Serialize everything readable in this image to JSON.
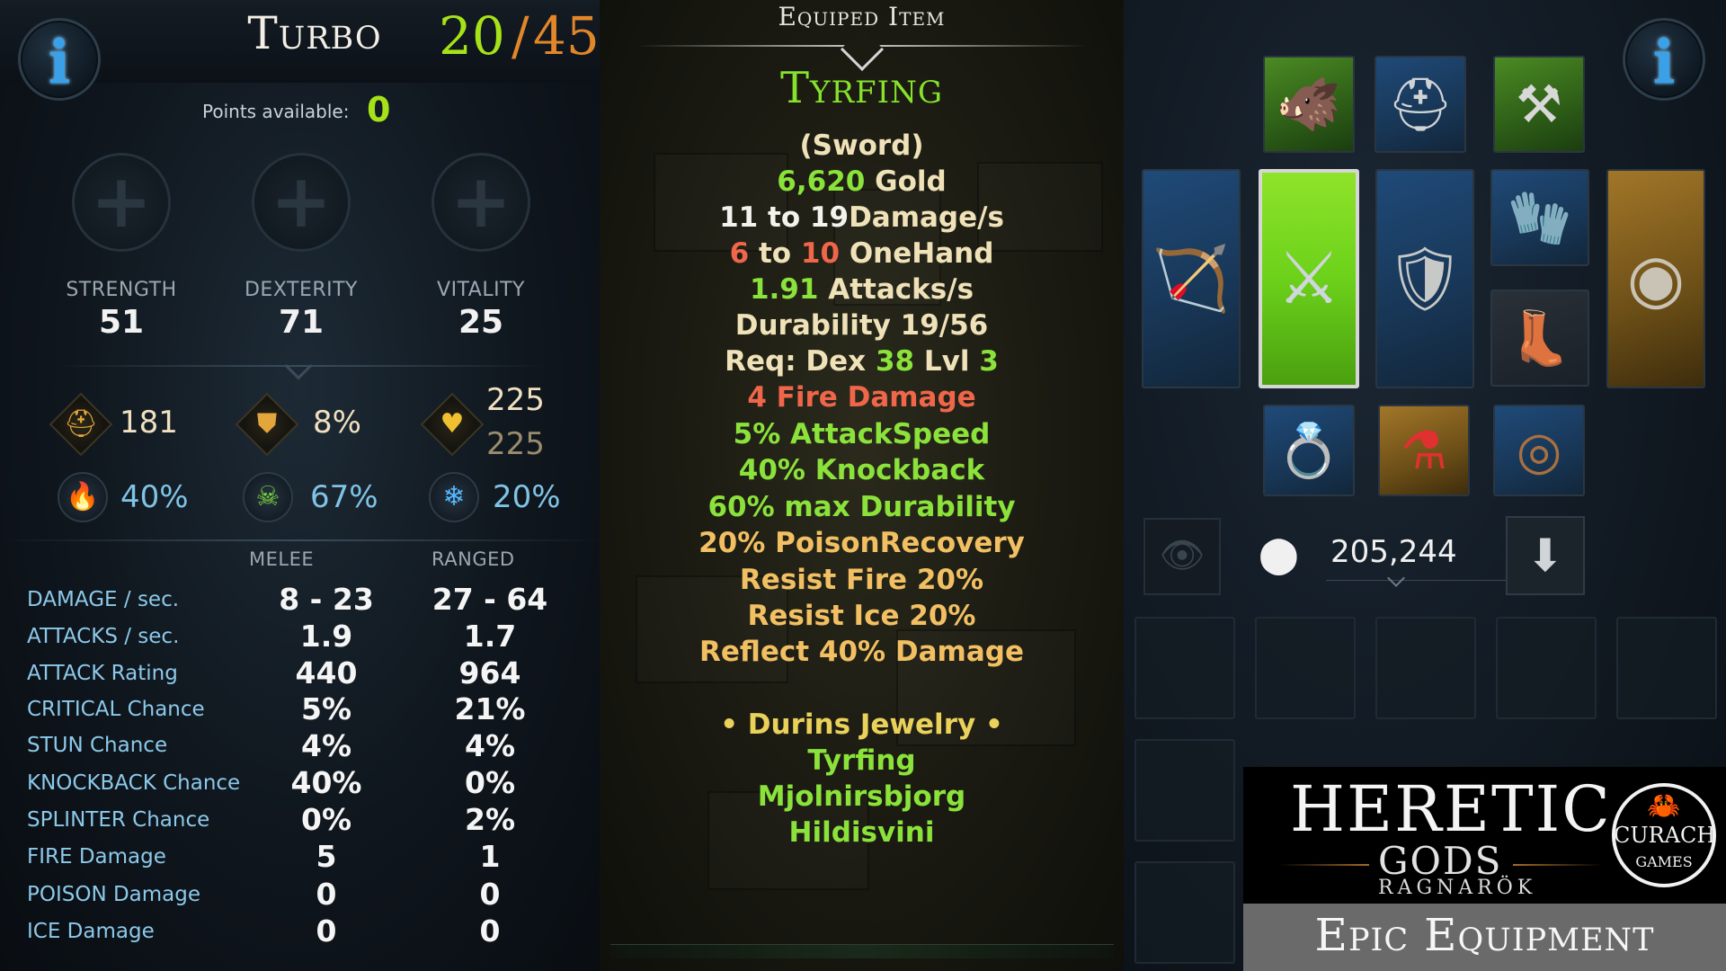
{
  "character": {
    "name": "Turbo",
    "level_current": "20",
    "level_separator": "/",
    "level_max": "45",
    "points_label": "Points available:",
    "points_value": "0"
  },
  "attributes": [
    {
      "name": "STRENGTH",
      "value": "51"
    },
    {
      "name": "DEXTERITY",
      "value": "71"
    },
    {
      "name": "VITALITY",
      "value": "25"
    }
  ],
  "derived": {
    "armor": "181",
    "block": "8%",
    "health_current": "225",
    "health_max": "225",
    "fire_resist": "40%",
    "poison_resist": "67%",
    "ice_resist": "20%"
  },
  "combat_table": {
    "headers": [
      "MELEE",
      "RANGED"
    ],
    "rows": [
      {
        "label": "DAMAGE / sec.",
        "melee": "8 - 23",
        "ranged": "27 - 64"
      },
      {
        "label": "ATTACKS / sec.",
        "melee": "1.9",
        "ranged": "1.7"
      },
      {
        "label": "ATTACK Rating",
        "melee": "440",
        "ranged": "964"
      },
      {
        "label": "CRITICAL Chance",
        "melee": "5%",
        "ranged": "21%"
      },
      {
        "label": "STUN Chance",
        "melee": "4%",
        "ranged": "4%"
      },
      {
        "label": "KNOCKBACK Chance",
        "melee": "40%",
        "ranged": "0%"
      },
      {
        "label": "SPLINTER Chance",
        "melee": "0%",
        "ranged": "2%"
      },
      {
        "label": "FIRE Damage",
        "melee": "5",
        "ranged": "1"
      },
      {
        "label": "POISON Damage",
        "melee": "0",
        "ranged": "0"
      },
      {
        "label": "ICE Damage",
        "melee": "0",
        "ranged": "0"
      }
    ]
  },
  "item": {
    "panel_title": "Equiped Item",
    "name": "Tyrfing",
    "type": "(Sword)",
    "gold": "6,620",
    "gold_unit": "Gold",
    "damage_min": "11",
    "damage_to": "to",
    "damage_max": "19",
    "damage_unit": "Damage/s",
    "hand_min": "6",
    "hand_to": "to",
    "hand_max": "10",
    "hand_unit": "OneHand",
    "attacks_value": "1.91",
    "attacks_unit": "Attacks/s",
    "durability": "Durability 19/56",
    "req_prefix": "Req: Dex",
    "req_dex": "38",
    "req_lvl_label": "Lvl",
    "req_lvl": "3",
    "mods": [
      "4 Fire Damage",
      "5% AttackSpeed",
      "40% Knockback",
      "60% max Durability",
      "20% PoisonRecovery",
      "Resist Fire 20%",
      "Resist Ice 20%",
      "Reflect 40% Damage"
    ],
    "set_name": "• Durins Jewelry •",
    "set_items": [
      "Tyrfing",
      "Mjolnirsbjorg",
      "Hildisvini"
    ]
  },
  "inventory": {
    "gold": "205,244"
  },
  "icons": {
    "info": "info-icon",
    "plus": "plus-icon",
    "armor": "helmet-icon",
    "block": "shield-icon",
    "health": "heart-icon",
    "fire": "fire-icon",
    "poison": "skull-icon",
    "ice": "snowflake-icon",
    "eye": "eye-icon",
    "coins": "coins-icon",
    "sort": "down-arrow-icon"
  },
  "colors": {
    "level_current": "#a6e218",
    "level_max": "#e2862a",
    "item_name": "#86e22c",
    "legendary_slot": "#8fe32a"
  },
  "branding": {
    "game_title": "HERETIC",
    "game_subtitle": "GODS",
    "game_tagline": "RAGNARÖK",
    "studio_name": "CURACHA",
    "studio_sub": "GAMES",
    "caption": "Epic Equipment"
  }
}
